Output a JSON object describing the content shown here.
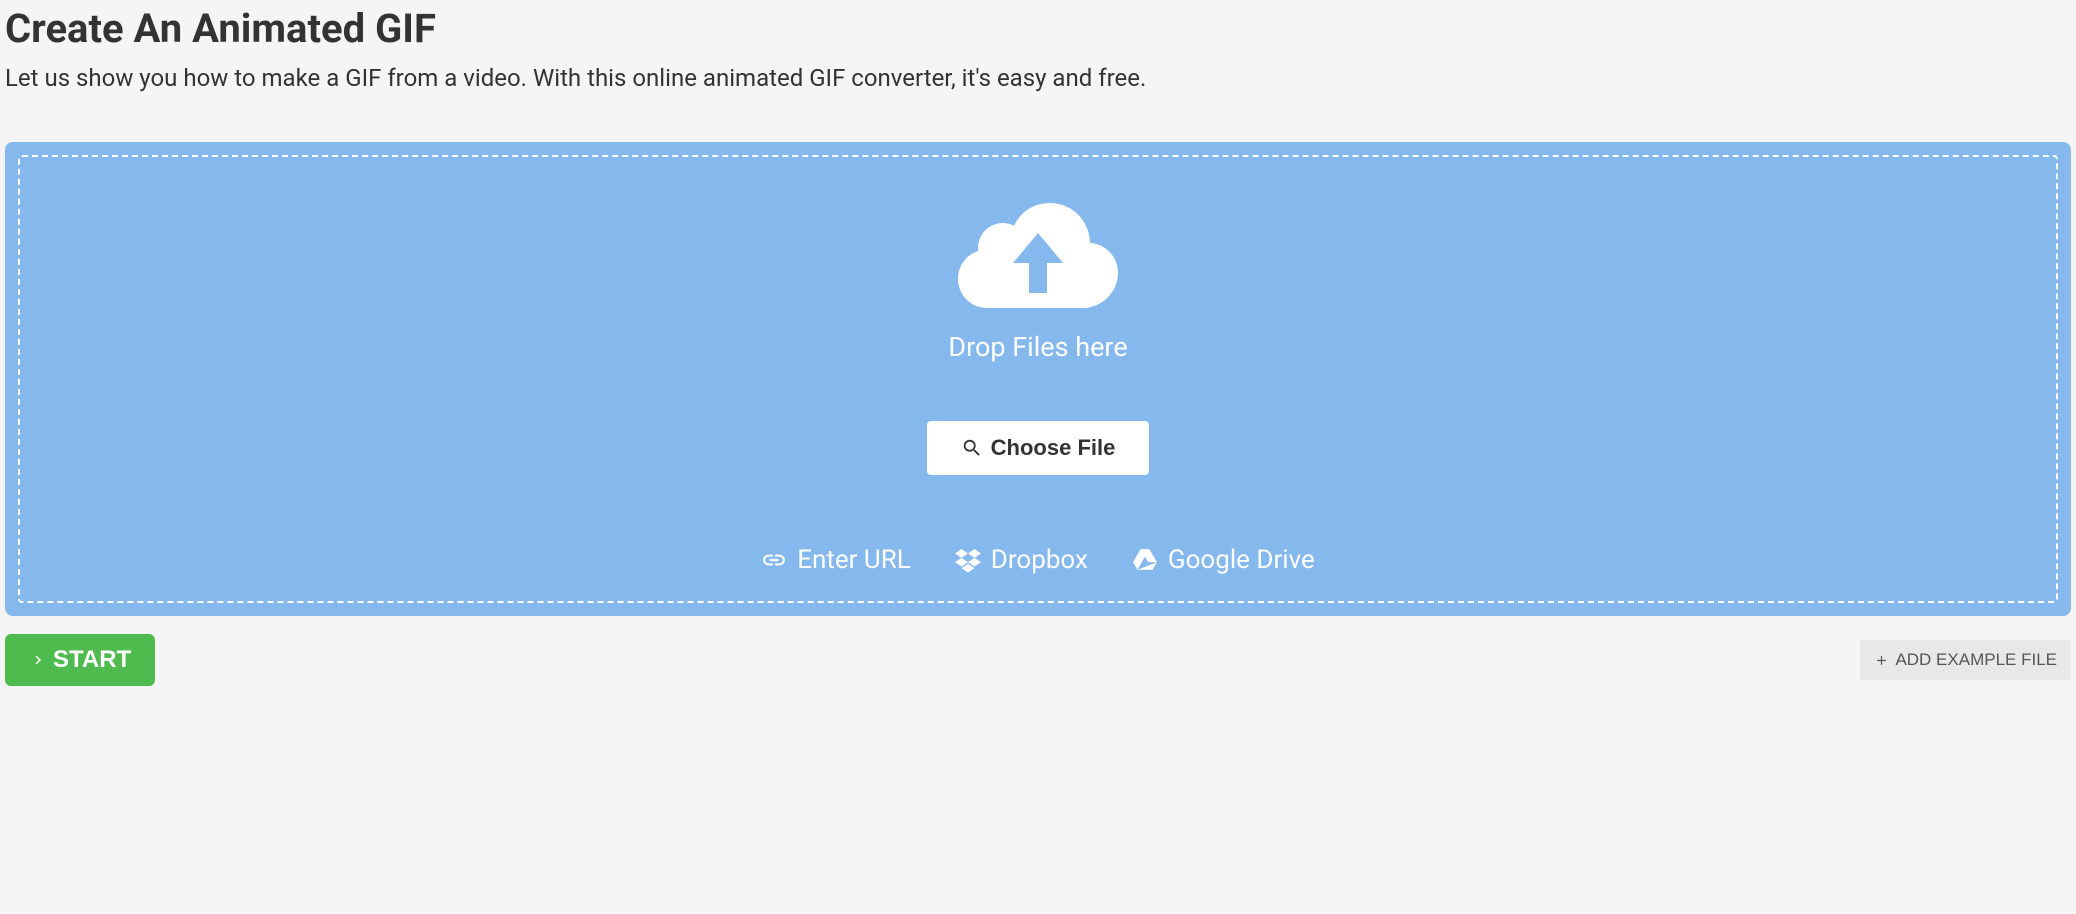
{
  "header": {
    "title": "Create An Animated GIF",
    "subtitle": "Let us show you how to make a GIF from a video. With this online animated GIF converter, it's easy and free."
  },
  "dropzone": {
    "drop_text": "Drop Files here",
    "choose_file_label": "Choose File",
    "sources": {
      "url": "Enter URL",
      "dropbox": "Dropbox",
      "google_drive": "Google Drive"
    }
  },
  "actions": {
    "start_label": "START",
    "add_example_label": "ADD EXAMPLE FILE"
  }
}
